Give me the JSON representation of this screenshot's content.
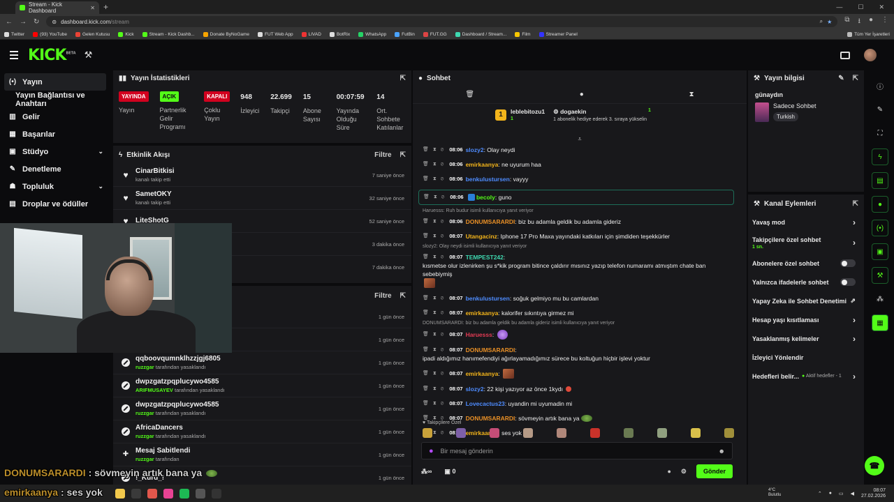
{
  "browser": {
    "tab_title": "Stream - Kick Dashboard",
    "url_domain": "dashboard.kick.com",
    "url_path": "/stream",
    "bookmarks": [
      "Twitter",
      "(93) YouTube",
      "Gelen Kutusu",
      "Kick",
      "Stream - Kick Dashb...",
      "Donate ByNoGame",
      "FUT Web App",
      "LIVAD",
      "BotRix",
      "WhatsApp",
      "FutBin",
      "FUT.GG",
      "Dashboard / Stream...",
      "Film",
      "Streamer Panel"
    ],
    "all_bookmarks": "Tüm Yer İşaretleri"
  },
  "brand": {
    "logo": "KICK",
    "beta": "BETA"
  },
  "sidebar": {
    "items": [
      {
        "label": "Yayın",
        "icon": "(•)"
      },
      {
        "label": "Yayın Bağlantısı ve Anahtarı"
      },
      {
        "label": "Gelir",
        "icon": "▥"
      },
      {
        "label": "Başarılar",
        "icon": "▦"
      },
      {
        "label": "Stüdyo",
        "icon": "▣"
      },
      {
        "label": "Denetleme",
        "icon": "✎"
      },
      {
        "label": "Topluluk",
        "icon": "☗"
      },
      {
        "label": "Droplar ve ödüller",
        "icon": "▤"
      }
    ]
  },
  "stats_panel": {
    "title": "Yayın İstatistikleri",
    "stats": [
      {
        "badge": "YAYINDA",
        "label": "Yayın"
      },
      {
        "badge": "AÇIK",
        "label": "Partnerlik Gelir Programı"
      },
      {
        "badge": "KAPALI",
        "label": "Çoklu Yayın"
      },
      {
        "value": "948",
        "label": "İzleyici"
      },
      {
        "value": "22.699",
        "label": "Takipçi"
      },
      {
        "value": "15",
        "label": "Abone Sayısı"
      },
      {
        "value": "00:07:59",
        "label": "Yayında Olduğu Süre"
      },
      {
        "value": "14",
        "label": "Ort. Sohbete Katılanlar"
      }
    ]
  },
  "activity": {
    "title": "Etkinlik Akışı",
    "filter": "Filtre",
    "items": [
      {
        "name": "CinarBitkisi",
        "sub": "kanalı takip etti",
        "time": "7 saniye önce"
      },
      {
        "name": "SametOKY",
        "sub": "kanalı takip etti",
        "time": "32 saniye önce"
      },
      {
        "name": "LiteShotG",
        "sub": "",
        "time": "52 saniye önce"
      },
      {
        "name": "",
        "sub": "",
        "time": "3 dakika önce"
      },
      {
        "name": "",
        "sub": "",
        "time": "7 dakika önce"
      }
    ]
  },
  "moderation": {
    "filter": "Filtre",
    "items": [
      {
        "name": "",
        "mod": "",
        "action": "",
        "time": "1 gün önce"
      },
      {
        "name": "",
        "mod": "",
        "action": "",
        "time": "1 gün önce"
      },
      {
        "name": "qqboovqumnklhzzjgj6805",
        "mod": "ruzzgar",
        "action": "tarafından yasaklandı",
        "time": "1 gün önce"
      },
      {
        "name": "dwpzgatzpqplucywo4585",
        "mod": "ARIFMUSAYEV",
        "action": "tarafından yasaklandı",
        "time": "1 gün önce"
      },
      {
        "name": "dwpzgatzpqplucywo4585",
        "mod": "ruzzgar",
        "action": "tarafından yasaklandı",
        "time": "1 gün önce"
      },
      {
        "name": "AfricaDancers",
        "mod": "ruzzgar",
        "action": "tarafından yasaklandı",
        "time": "1 gün önce"
      },
      {
        "name": "Mesaj Sabitlendi",
        "mod": "ruzzgar",
        "action": "tarafından",
        "time": "1 gün önce"
      },
      {
        "name": "!_Kurd_!",
        "mod": "",
        "action": "",
        "time": "1 gün önce"
      }
    ]
  },
  "chat": {
    "title": "Sohbet",
    "pinned": {
      "rank": "1",
      "gifter": "leblebitozu1",
      "gifter_count": "1",
      "recipient": "dogaekin",
      "recipient_count": "1",
      "description": "1 abonelik hediye ederek 3. sıraya yükselin"
    },
    "messages": [
      {
        "time": "08:06",
        "user": "slozy2",
        "color": "#4e8cff",
        "text": "Olay neydi"
      },
      {
        "time": "08:06",
        "user": "emirkaanya",
        "color": "#f3b41b",
        "text": "ne uyurum haa"
      },
      {
        "time": "08:06",
        "user": "benkulustursen",
        "color": "#4e8cff",
        "text": "vayyy"
      },
      {
        "time": "08:06",
        "user": "becoly",
        "color": "#53fc18",
        "text": "guno",
        "highlight": true
      },
      {
        "reply": "Haruesss: Ruh budur isimli kullanıcıya yanıt veriyor"
      },
      {
        "time": "08:06",
        "user": "DONUMSARARDI",
        "color": "#e88f26",
        "text": "biz bu adamla geldik bu adamla gideriz"
      },
      {
        "time": "08:07",
        "user": "Utangacinz",
        "color": "#f3b41b",
        "text": "Iphone 17 Pro Maxa yayındaki katkıları için şimdiden teşekkürler"
      },
      {
        "reply": "slozy2: Olay neydi isimli kullanıcıya yanıt veriyor"
      },
      {
        "time": "08:07",
        "user": "TEMPEST242",
        "color": "#3ed8b0",
        "text": "kısmetse olur izlenirken şu s*kik program bitince çaldırır mısınız yazıp telefon numaramı atmıştım chate ban sebebiymiş",
        "emote": true
      },
      {
        "time": "08:07",
        "user": "benkulustursen",
        "color": "#4e8cff",
        "text": "soğuk gelmiyo mu bu camlardan"
      },
      {
        "time": "08:07",
        "user": "emirkaanya",
        "color": "#f3b41b",
        "text": "kalorifer sıkıntıya girmez mi"
      },
      {
        "reply": "DONUMSARARDI: biz bu adamla geldik bu adamla gideriz isimli kullanıcıya yanıt veriyor"
      },
      {
        "time": "08:07",
        "user": "Haruesss",
        "color": "#e53b54",
        "text": "",
        "emote": "heart"
      },
      {
        "time": "08:07",
        "user": "DONUMSARARDI",
        "color": "#e88f26",
        "text": "ipadi aldığımız hanımefendiyi ağırlayamadığımız sürece bu koltuğun hiçbir işlevi yoktur"
      },
      {
        "time": "08:07",
        "user": "emirkaanya",
        "color": "#f3b41b",
        "text": "",
        "emote": true
      },
      {
        "time": "08:07",
        "user": "slozy2",
        "color": "#4e8cff",
        "text": "22 kişi yazıyor az önce 1kydı"
      },
      {
        "time": "08:07",
        "user": "Lovecactus23",
        "color": "#4e8cff",
        "text": "uyandin mi uyumadin mi"
      },
      {
        "time": "08:07",
        "user": "DONUMSARARDI",
        "color": "#e88f26",
        "text": "sövmeyin artık bana ya",
        "emote": "frog"
      },
      {
        "time": "08:07",
        "user": "emirkaanya",
        "color": "#f3b41b",
        "text": "ses yok"
      }
    ],
    "followers_label": "Takipçilere Özel",
    "input_placeholder": "Bir mesaj gönderin",
    "points": "0",
    "send_label": "Gönder"
  },
  "stream_info": {
    "title": "Yayın bilgisi",
    "stream_title": "günaydın",
    "category": "Sadece Sohbet",
    "tag": "Turkish"
  },
  "channel_actions": {
    "title": "Kanal Eylemleri",
    "rows": [
      {
        "label": "Yavaş mod",
        "kind": "chev"
      },
      {
        "label": "Takipçilere özel sohbet",
        "sub": "1 sn.",
        "kind": "chev"
      },
      {
        "label": "Abonelere özel sohbet",
        "kind": "toggle"
      },
      {
        "label": "Yalnızca ifadelerle sohbet",
        "kind": "toggle"
      },
      {
        "label": "Yapay Zeka ile Sohbet Denetimi",
        "kind": "ext"
      },
      {
        "label": "Hesap yaşı kısıtlaması",
        "kind": "chev"
      },
      {
        "label": "Yasaklanmış kelimeler",
        "kind": "chev"
      },
      {
        "label": "İzleyici Yönlendir",
        "kind": "none"
      },
      {
        "label": "Hedefleri belir...",
        "sub": "Aktif hedefler - 1",
        "kind": "chev"
      }
    ]
  },
  "overlay": {
    "line1_user": "DONUMSARARDI",
    "line1_text": ": sövmeyin artık bana ya",
    "line2_user": "emirkaanya",
    "line2_text": ": ses yok"
  },
  "taskbar": {
    "weather_temp": "4°C",
    "weather_desc": "Bulutlu",
    "time": "08:07",
    "date": "27.02.2026"
  },
  "colors": {
    "accent": "#53fc18",
    "live": "#d1021f",
    "panel": "#18181b"
  }
}
